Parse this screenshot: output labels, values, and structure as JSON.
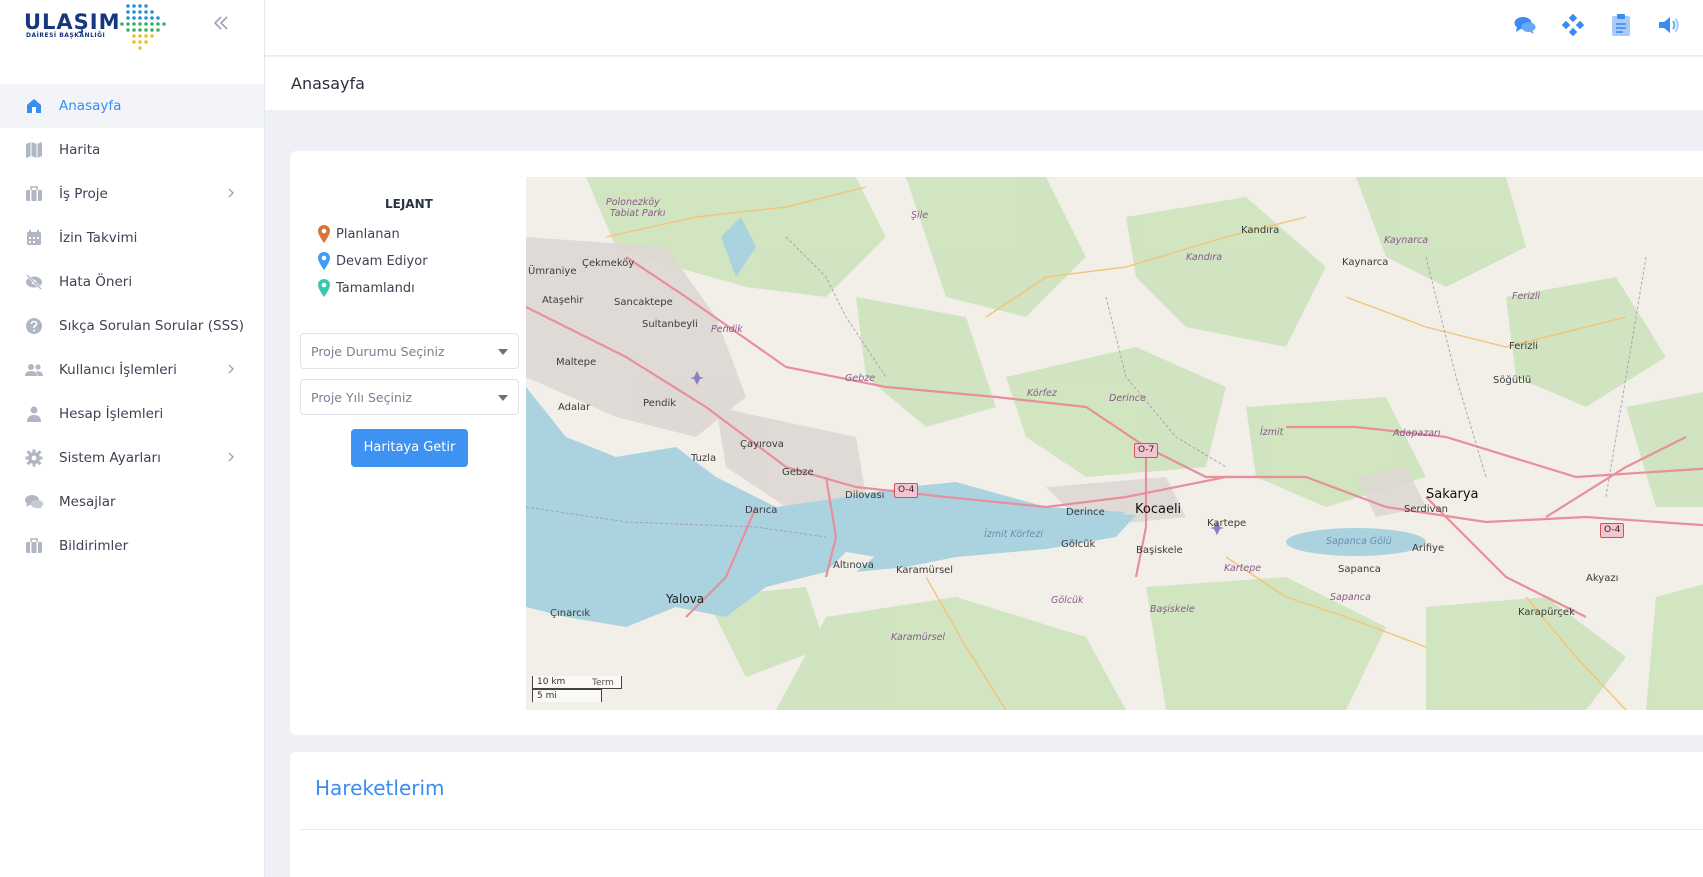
{
  "brand": {
    "name": "ULAŞIM",
    "subtitle": "DAİRESİ BAŞKANLIĞI"
  },
  "sidebar": {
    "collapse_icon": "double-chevron-left-icon",
    "items": [
      {
        "label": "Anasayfa",
        "icon": "home-icon",
        "active": true,
        "has_submenu": false
      },
      {
        "label": "Harita",
        "icon": "map-icon",
        "active": false,
        "has_submenu": false
      },
      {
        "label": "İş Proje",
        "icon": "briefcase-icon",
        "active": false,
        "has_submenu": true
      },
      {
        "label": "İzin Takvimi",
        "icon": "calendar-icon",
        "active": false,
        "has_submenu": false
      },
      {
        "label": "Hata Öneri",
        "icon": "eye-slash-icon",
        "active": false,
        "has_submenu": false
      },
      {
        "label": "Sıkça Sorulan Sorular (SSS)",
        "icon": "question-circle-icon",
        "active": false,
        "has_submenu": false
      },
      {
        "label": "Kullanıcı İşlemleri",
        "icon": "users-icon",
        "active": false,
        "has_submenu": true
      },
      {
        "label": "Hesap İşlemleri",
        "icon": "user-icon",
        "active": false,
        "has_submenu": false
      },
      {
        "label": "Sistem Ayarları",
        "icon": "gear-icon",
        "active": false,
        "has_submenu": true
      },
      {
        "label": "Mesajlar",
        "icon": "comments-icon",
        "active": false,
        "has_submenu": false
      },
      {
        "label": "Bildirimler",
        "icon": "briefcase-icon",
        "active": false,
        "has_submenu": false
      }
    ]
  },
  "topbar": {
    "icons": [
      "chat-icon",
      "diamond-nodes-icon",
      "clipboard-icon",
      "volume-icon"
    ],
    "accent": "#3b8cf0"
  },
  "page": {
    "title": "Anasayfa"
  },
  "legend": {
    "title": "LEJANT",
    "items": [
      {
        "label": "Planlanan",
        "color": "#d9743a"
      },
      {
        "label": "Devam Ediyor",
        "color": "#3f9cf5"
      },
      {
        "label": "Tamamlandı",
        "color": "#3ac9b0"
      }
    ]
  },
  "filters": {
    "status_placeholder": "Proje Durumu Seçiniz",
    "year_placeholder": "Proje Yılı Seçiniz",
    "submit_label": "Haritaya Getir"
  },
  "map": {
    "labels": {
      "sile": "Şile",
      "kandira": "Kandıra",
      "kandira_district": "Kandıra",
      "kaynarca": "Kaynarca",
      "kaynarca_district": "Kaynarca",
      "polonezkoy": "Polonezköy",
      "polonezkoy2": "Tabiat Parkı",
      "cekmekoy": "Çekmeköy",
      "umraniye": "Ümraniye",
      "atasehir": "Ataşehir",
      "sancaktepe": "Sancaktepe",
      "sultanbeyli": "Sultanbeyli",
      "pendik_district": "Pendik",
      "maltepe": "Maltepe",
      "adalar": "Adalar",
      "pendik": "Pendik",
      "tuzla": "Tuzla",
      "cayirova": "Çayırova",
      "gebze": "Gebze",
      "gebze_district": "Gebze",
      "darica": "Darıca",
      "dilovasi": "Dilovası",
      "korfez": "Körfez",
      "derince_district": "Derince",
      "derince": "Derince",
      "kocaeli": "Kocaeli",
      "kartepe": "Kartepe",
      "kartepe_district": "Kartepe",
      "izmit": "İzmit",
      "izmit_korfezi": "İzmit Körfezi",
      "golcuk": "Gölcük",
      "golcuk_district": "Gölcük",
      "basiskele": "Başiskele",
      "basiskele_district": "Başiskele",
      "altinova": "Altınova",
      "karamursel": "Karamürsel",
      "karamursel_district": "Karamürsel",
      "yalova": "Yalova",
      "cinarcik": "Çınarcık",
      "sakarya": "Sakarya",
      "serdivan": "Serdivan",
      "adapazari": "Adapazarı",
      "sapanca": "Sapanca",
      "sapanca_golu": "Sapanca Gölü",
      "sapanca_district": "Sapanca",
      "arifiye": "Arifiye",
      "ferizli": "Ferizli",
      "ferizli_district": "Ferizli",
      "sogutlu": "Söğütlü",
      "akyazi": "Akyazı",
      "karapurcek": "Karapürçek",
      "o4a": "O-4",
      "o4b": "O-4",
      "o7": "O-7",
      "scale_km": "10 km",
      "scale_mi": "5 mi",
      "attrib": "Term"
    }
  },
  "activity": {
    "title": "Hareketlerim"
  }
}
